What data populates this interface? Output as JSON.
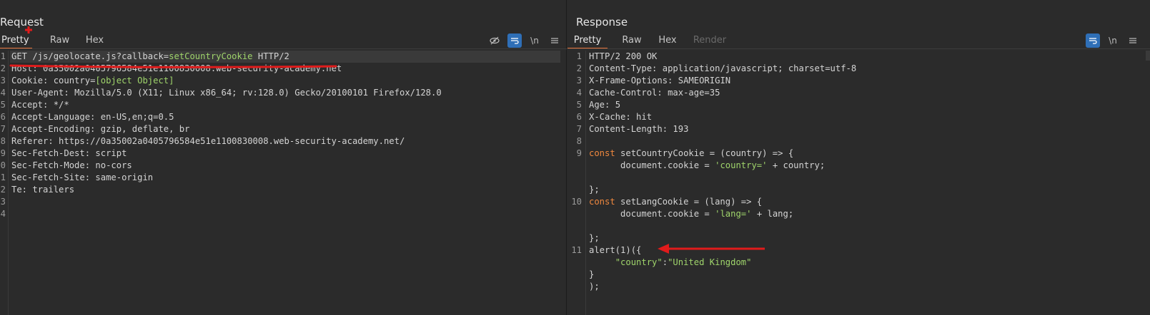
{
  "request": {
    "title": "Request",
    "tabs": [
      {
        "label": "Pretty",
        "active": true
      },
      {
        "label": "Raw",
        "active": false
      },
      {
        "label": "Hex",
        "active": false
      }
    ],
    "toolbar": {
      "newline_label": "\\n"
    },
    "lines": [
      {
        "num": "1",
        "parts": [
          {
            "t": "GET /js/geolocate.js?callback=",
            "c": "k"
          },
          {
            "t": "setCountryCookie",
            "c": "g"
          },
          {
            "t": " HTTP/2",
            "c": "k"
          }
        ]
      },
      {
        "num": "2",
        "parts": [
          {
            "t": "Host: ",
            "c": "k"
          },
          {
            "t": "0a35002a0405796584e51e1100830008.web-security-academy.net",
            "c": "v"
          }
        ]
      },
      {
        "num": "3",
        "parts": [
          {
            "t": "Cookie: ",
            "c": "k"
          },
          {
            "t": "country=",
            "c": "v"
          },
          {
            "t": "[object Object]",
            "c": "g"
          }
        ]
      },
      {
        "num": "4",
        "parts": [
          {
            "t": "User-Agent: ",
            "c": "k"
          },
          {
            "t": "Mozilla/5.0 (X11; Linux x86_64; rv:128.0) Gecko/20100101 Firefox/128.0",
            "c": "v"
          }
        ]
      },
      {
        "num": "5",
        "parts": [
          {
            "t": "Accept: ",
            "c": "k"
          },
          {
            "t": "*/*",
            "c": "v"
          }
        ]
      },
      {
        "num": "6",
        "parts": [
          {
            "t": "Accept-Language: ",
            "c": "k"
          },
          {
            "t": "en-US,en;q=0.5",
            "c": "v"
          }
        ]
      },
      {
        "num": "7",
        "parts": [
          {
            "t": "Accept-Encoding: ",
            "c": "k"
          },
          {
            "t": "gzip, deflate, br",
            "c": "v"
          }
        ]
      },
      {
        "num": "8",
        "parts": [
          {
            "t": "Referer: ",
            "c": "k"
          },
          {
            "t": "https://0a35002a0405796584e51e1100830008.web-security-academy.net/",
            "c": "v"
          }
        ]
      },
      {
        "num": "9",
        "parts": [
          {
            "t": "Sec-Fetch-Dest: ",
            "c": "k"
          },
          {
            "t": "script",
            "c": "v"
          }
        ]
      },
      {
        "num": "0",
        "parts": [
          {
            "t": "Sec-Fetch-Mode: ",
            "c": "k"
          },
          {
            "t": "no-cors",
            "c": "v"
          }
        ]
      },
      {
        "num": "1",
        "parts": [
          {
            "t": "Sec-Fetch-Site: ",
            "c": "k"
          },
          {
            "t": "same-origin",
            "c": "v"
          }
        ]
      },
      {
        "num": "2",
        "parts": [
          {
            "t": "Te: ",
            "c": "k"
          },
          {
            "t": "trailers",
            "c": "v"
          }
        ]
      },
      {
        "num": "3",
        "parts": []
      },
      {
        "num": "4",
        "parts": []
      }
    ]
  },
  "response": {
    "title": "Response",
    "tabs": [
      {
        "label": "Pretty",
        "active": true
      },
      {
        "label": "Raw",
        "active": false
      },
      {
        "label": "Hex",
        "active": false
      },
      {
        "label": "Render",
        "active": false,
        "disabled": true
      }
    ],
    "toolbar": {
      "newline_label": "\\n"
    },
    "lines": [
      {
        "num": "1",
        "parts": [
          {
            "t": "HTTP/2 200 OK",
            "c": "k"
          }
        ]
      },
      {
        "num": "2",
        "parts": [
          {
            "t": "Content-Type: ",
            "c": "k"
          },
          {
            "t": "application/javascript; charset=utf-8",
            "c": "v"
          }
        ]
      },
      {
        "num": "3",
        "parts": [
          {
            "t": "X-Frame-Options: ",
            "c": "k"
          },
          {
            "t": "SAMEORIGIN",
            "c": "v"
          }
        ]
      },
      {
        "num": "4",
        "parts": [
          {
            "t": "Cache-Control: ",
            "c": "k"
          },
          {
            "t": "max-age=35",
            "c": "v"
          }
        ]
      },
      {
        "num": "5",
        "parts": [
          {
            "t": "Age: ",
            "c": "k"
          },
          {
            "t": "5",
            "c": "v"
          }
        ]
      },
      {
        "num": "6",
        "parts": [
          {
            "t": "X-Cache: ",
            "c": "k"
          },
          {
            "t": "hit",
            "c": "v"
          }
        ]
      },
      {
        "num": "7",
        "parts": [
          {
            "t": "Content-Length: ",
            "c": "k"
          },
          {
            "t": "193",
            "c": "v"
          }
        ]
      },
      {
        "num": "8",
        "parts": []
      },
      {
        "num": "9",
        "parts": [
          {
            "t": "const",
            "c": "kw"
          },
          {
            "t": " setCountryCookie = (country) => {",
            "c": "k"
          }
        ]
      },
      {
        "num": "",
        "parts": [
          {
            "t": "      document.cookie = ",
            "c": "k"
          },
          {
            "t": "'country='",
            "c": "str"
          },
          {
            "t": " + country;",
            "c": "k"
          }
        ]
      },
      {
        "num": "",
        "parts": []
      },
      {
        "num": "",
        "parts": [
          {
            "t": "};",
            "c": "k"
          }
        ]
      },
      {
        "num": "10",
        "parts": [
          {
            "t": "const",
            "c": "kw"
          },
          {
            "t": " setLangCookie = (lang) => {",
            "c": "k"
          }
        ]
      },
      {
        "num": "",
        "parts": [
          {
            "t": "      document.cookie = ",
            "c": "k"
          },
          {
            "t": "'lang='",
            "c": "str"
          },
          {
            "t": " + lang;",
            "c": "k"
          }
        ]
      },
      {
        "num": "",
        "parts": []
      },
      {
        "num": "",
        "parts": [
          {
            "t": "};",
            "c": "k"
          }
        ]
      },
      {
        "num": "11",
        "parts": [
          {
            "t": "alert(1)({",
            "c": "k"
          }
        ]
      },
      {
        "num": "",
        "parts": [
          {
            "t": "     ",
            "c": "k"
          },
          {
            "t": "\"country\"",
            "c": "str"
          },
          {
            "t": ":",
            "c": "k"
          },
          {
            "t": "\"United Kingdom\"",
            "c": "str"
          }
        ]
      },
      {
        "num": "",
        "parts": [
          {
            "t": "}",
            "c": "k"
          }
        ]
      },
      {
        "num": "",
        "parts": [
          {
            "t": ");",
            "c": "k"
          }
        ]
      }
    ]
  },
  "colors": {
    "accent": "#2f6fb7",
    "tab_underline": "#e8743b",
    "annotation": "#e01b1b"
  }
}
